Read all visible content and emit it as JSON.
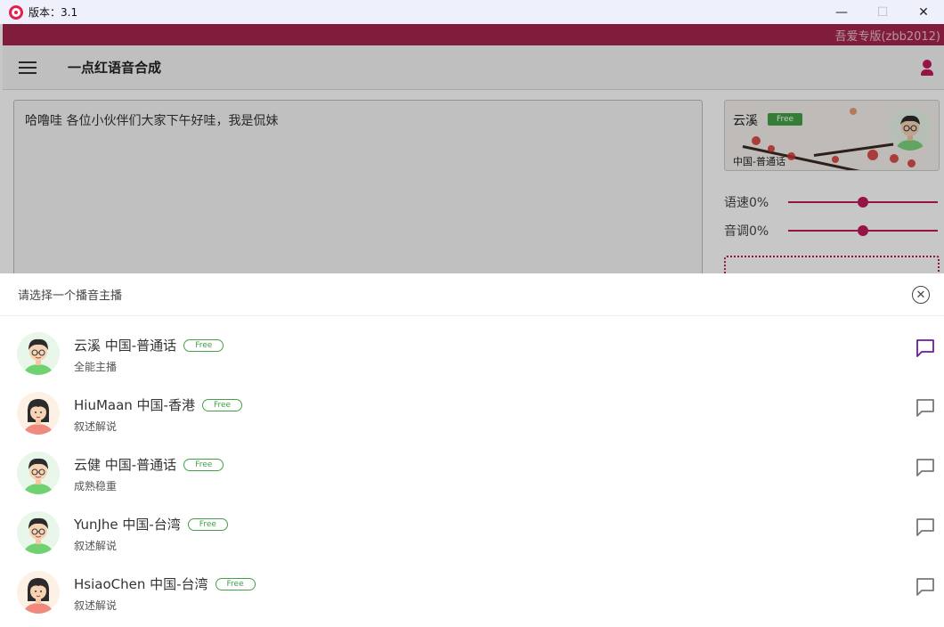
{
  "window": {
    "title": "版本：3.1",
    "minimize": "—",
    "maximize": "☐",
    "close": "✕"
  },
  "brand": {
    "text": "吾爱专版(zbb2012)"
  },
  "toolbar": {
    "title": "一点红语音合成"
  },
  "editor": {
    "text": "哈噜哇 各位小伙伴们大家下午好哇，我是侃妹"
  },
  "current_voice": {
    "name": "云溪",
    "badge": "Free",
    "region": "中国-普通话"
  },
  "sliders": [
    {
      "label": "语速0%",
      "value": 0
    },
    {
      "label": "音调0%",
      "value": 0
    }
  ],
  "sheet": {
    "title": "请选择一个播音主播",
    "close_icon": "close-circle-icon",
    "voices": [
      {
        "name": "云溪 中国-普通话",
        "badge": "Free",
        "desc": "全能主播",
        "gender": "male",
        "selected": true
      },
      {
        "name": "HiuMaan 中国-香港",
        "badge": "Free",
        "desc": "叙述解说",
        "gender": "female",
        "selected": false
      },
      {
        "name": "云健 中国-普通话",
        "badge": "Free",
        "desc": "成熟稳重",
        "gender": "male",
        "selected": false
      },
      {
        "name": "YunJhe 中国-台湾",
        "badge": "Free",
        "desc": "叙述解说",
        "gender": "male",
        "selected": false
      },
      {
        "name": "HsiaoChen 中国-台湾",
        "badge": "Free",
        "desc": "叙述解说",
        "gender": "female",
        "selected": false
      }
    ]
  },
  "colors": {
    "accent": "#c2185b",
    "brand_bar": "#a5244e",
    "free_green": "#43a047",
    "selected_icon": "#6a1b9a",
    "unselected_icon": "#777777"
  }
}
